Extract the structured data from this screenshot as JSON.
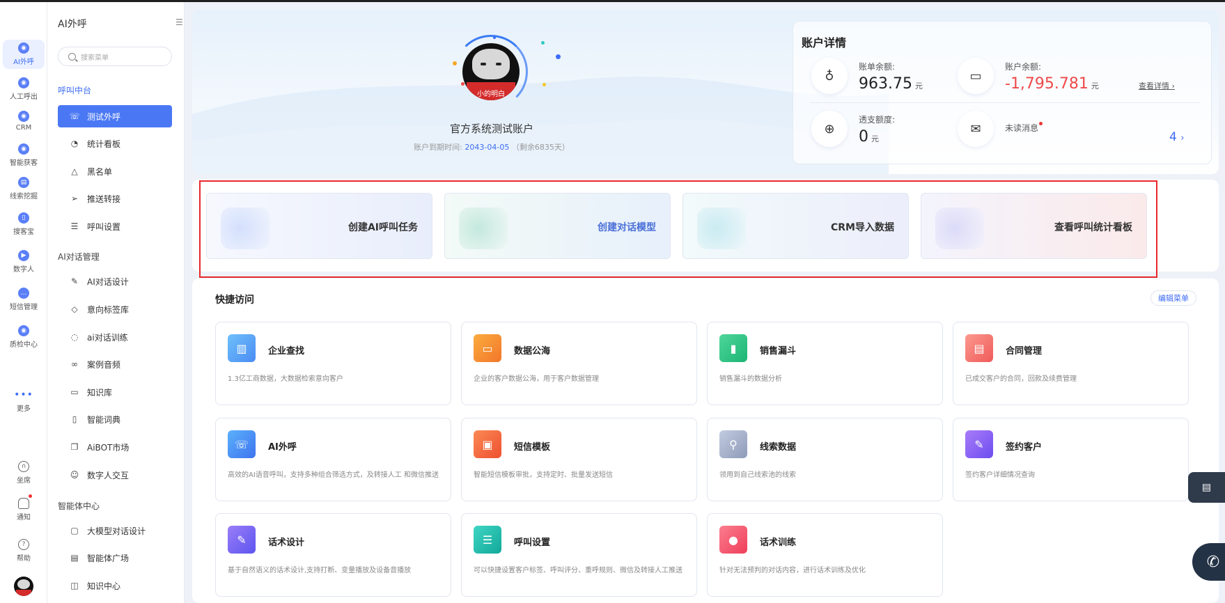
{
  "rail": {
    "items": [
      {
        "label": "AI外呼",
        "icon": "ai-call-icon"
      },
      {
        "label": "人工呼出",
        "icon": "manual-call-icon"
      },
      {
        "label": "CRM",
        "icon": "crm-icon"
      },
      {
        "label": "智能获客",
        "icon": "customer-acquisition-icon"
      },
      {
        "label": "线索挖掘",
        "icon": "lead-mining-icon"
      },
      {
        "label": "搜客宝",
        "icon": "search-customer-icon"
      },
      {
        "label": "数字人",
        "icon": "digital-human-icon"
      },
      {
        "label": "短信管理",
        "icon": "sms-icon"
      },
      {
        "label": "质检中心",
        "icon": "quality-check-icon"
      },
      {
        "label": "更多",
        "icon": "more-icon"
      }
    ],
    "bottom": [
      {
        "label": "坐席",
        "icon": "headset-icon"
      },
      {
        "label": "通知",
        "icon": "bell-icon"
      },
      {
        "label": "帮助",
        "icon": "help-icon"
      }
    ]
  },
  "sidebar": {
    "title": "AI外呼",
    "search_placeholder": "搜索菜单",
    "group1": "呼叫中台",
    "group1_items": [
      "测试外呼",
      "统计看板",
      "黑名单",
      "推送转接",
      "呼叫设置"
    ],
    "group2": "AI对话管理",
    "group2_items": [
      "AI对话设计",
      "意向标签库",
      "ai对话训练",
      "案例音频",
      "知识库",
      "智能词典",
      "AiBOT市场",
      "数字人交互"
    ],
    "group3": "智能体中心",
    "group3_items": [
      "大模型对话设计",
      "智能体广场",
      "知识中心"
    ]
  },
  "profile": {
    "avatar_caption": "小的明白",
    "account_name": "官方系统测试账户",
    "expire_label": "账户到期时间:",
    "expire_date": "2043-04-05",
    "expire_remaining": "（剩余6835天）"
  },
  "details": {
    "title": "账户详情",
    "bill_balance_label": "账单余额:",
    "bill_balance_value": "963.75",
    "account_balance_label": "账户余额:",
    "account_balance_value": "-1,795.781",
    "overdraft_label": "透支额度:",
    "overdraft_value": "0",
    "unread_label": "未读消息",
    "unread_count": "4",
    "unit": "元",
    "view_detail": "查看详情",
    "chevron": "›"
  },
  "actions": [
    {
      "label": "创建AI呼叫任务",
      "color": "#e9eefc"
    },
    {
      "label": "创建对话模型",
      "color": "#e7f4f0"
    },
    {
      "label": "CRM导入数据",
      "color": "#e4f3f6"
    },
    {
      "label": "查看呼叫统计看板",
      "color": "#ece9fb"
    }
  ],
  "quick": {
    "title": "快捷访问",
    "edit": "编辑菜单",
    "tiles": [
      {
        "title": "企业查找",
        "desc": "1.3亿工商数据，大数据检索意向客户",
        "color": "#5aa7f7",
        "glyph": "▥"
      },
      {
        "title": "数据公海",
        "desc": "企业的客户数据公海，用于客户数据管理",
        "color": "#f5892e",
        "glyph": "▭"
      },
      {
        "title": "销售漏斗",
        "desc": "销售漏斗的数据分析",
        "color": "#2cc586",
        "glyph": "▮"
      },
      {
        "title": "合同管理",
        "desc": "已成交客户的合同，回款及续费管理",
        "color": "#f36f6f",
        "glyph": "▤"
      },
      {
        "title": "AI外呼",
        "desc": "高效的AI语音呼叫，支持多种组合筛选方式，及转接人工 和微信推送",
        "color": "#4b8ff5",
        "glyph": "☏"
      },
      {
        "title": "短信模板",
        "desc": "智能短信模板审批，支持定时、批量发送短信",
        "color": "#f46a3f",
        "glyph": "▣"
      },
      {
        "title": "线索数据",
        "desc": "领用到自己线索池的线索",
        "color": "#9aa7c2",
        "glyph": "⚲"
      },
      {
        "title": "签约客户",
        "desc": "签约客户详细情况查询",
        "color": "#8a5cf5",
        "glyph": "✎"
      },
      {
        "title": "话术设计",
        "desc": "基于自然语义的话术设计,支持打断、变量播放及设备音播放",
        "color": "#7c5bf0",
        "glyph": "✎"
      },
      {
        "title": "呼叫设置",
        "desc": "可以快捷设置客户标签、呼叫评分、重呼规则、微信及转接人工推送",
        "color": "#1fbfae",
        "glyph": "☰"
      },
      {
        "title": "话术训练",
        "desc": "针对无法预判的对话内容，进行话术训练及优化",
        "color": "#f0546a",
        "glyph": "●"
      }
    ]
  },
  "colors": {
    "accent": "#4a78f5",
    "negative": "#ef4a4a",
    "highlight_box": "#e8262b"
  }
}
